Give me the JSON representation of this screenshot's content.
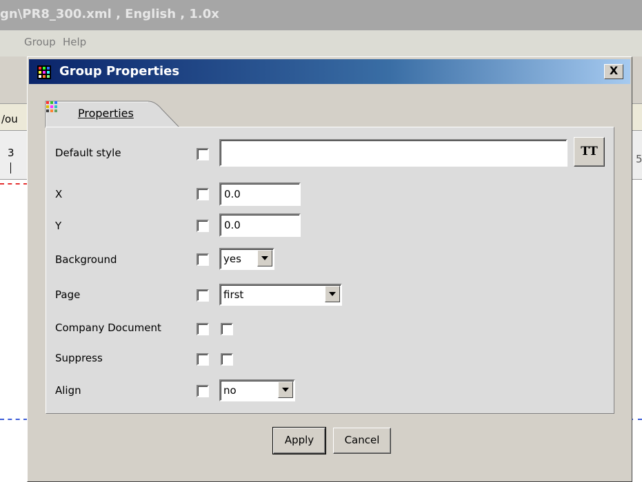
{
  "background_window": {
    "title": "gn\\PR8_300.xml , English , 1.0x",
    "menu": [
      "Group",
      "Help"
    ],
    "tab_fragment": "/ou",
    "ruler_left": "3",
    "ruler_right": "5"
  },
  "dialog": {
    "title": "Group Properties",
    "close_label": "X",
    "tab_label": "Properties",
    "style_button_glyph": "TT",
    "fields": {
      "default_style": {
        "label": "Default style",
        "value": ""
      },
      "x": {
        "label": "X",
        "value": "0.0"
      },
      "y": {
        "label": "Y",
        "value": "0.0"
      },
      "background": {
        "label": "Background",
        "value": "yes"
      },
      "page": {
        "label": "Page",
        "value": "first"
      },
      "company_document": {
        "label": "Company Document"
      },
      "suppress": {
        "label": "Suppress"
      },
      "align": {
        "label": "Align",
        "value": "no"
      }
    },
    "buttons": {
      "apply": "Apply",
      "cancel": "Cancel"
    }
  },
  "colors": {
    "title_gradient_start": "#0a246a",
    "title_gradient_end": "#a6caf0",
    "dialog_face": "#d4d0c8",
    "red_dash": "#e43030",
    "blue_dash": "#3a5ad8"
  }
}
